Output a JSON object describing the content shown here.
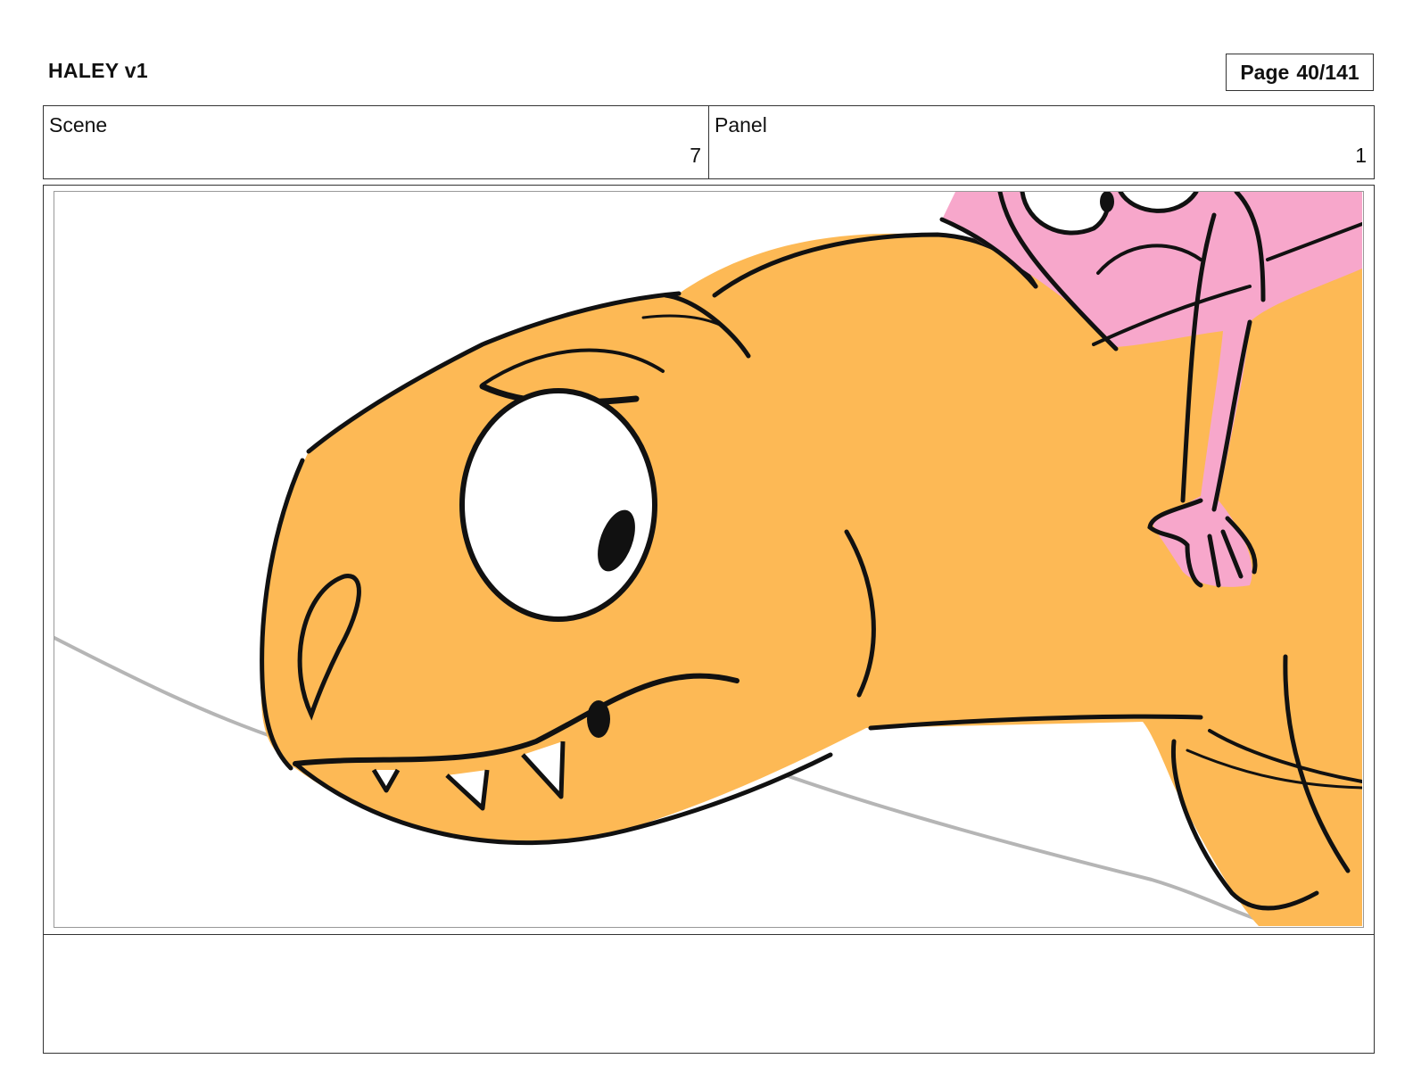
{
  "header": {
    "title": "HALEY v1",
    "page_label": "Page",
    "page_number": "40/141"
  },
  "info": {
    "scene_label": "Scene",
    "scene_value": "7",
    "panel_label": "Panel",
    "panel_value": "1"
  },
  "notes": {
    "text": ""
  },
  "colors": {
    "dino_fill": "#FDB955",
    "girl_fill": "#F7A7CB",
    "ink": "#111111",
    "ground": "#B5B5B5"
  }
}
